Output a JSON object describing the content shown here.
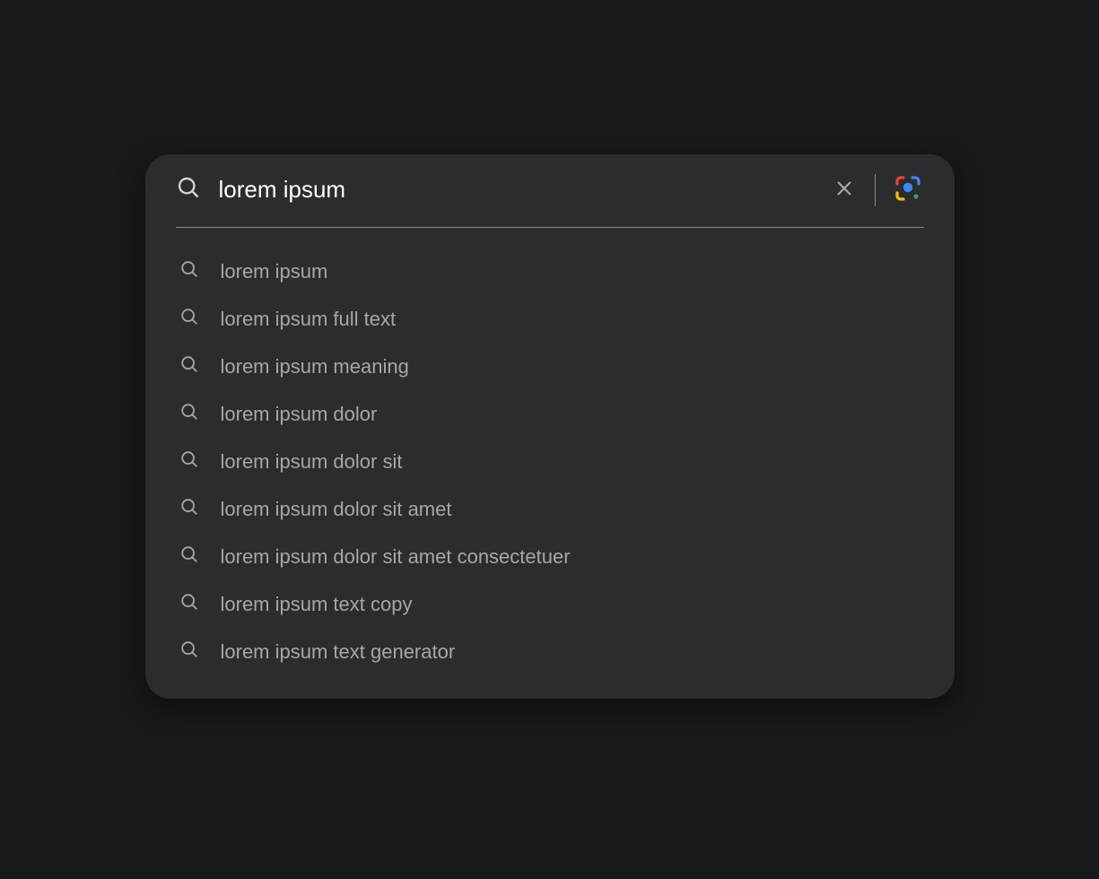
{
  "search": {
    "value": "lorem ipsum"
  },
  "suggestions": [
    "lorem ipsum",
    "lorem ipsum full text",
    "lorem ipsum meaning",
    "lorem ipsum dolor",
    "lorem ipsum dolor sit",
    "lorem ipsum dolor sit amet",
    "lorem ipsum dolor sit amet consectetuer",
    "lorem ipsum text copy",
    "lorem ipsum text generator"
  ]
}
